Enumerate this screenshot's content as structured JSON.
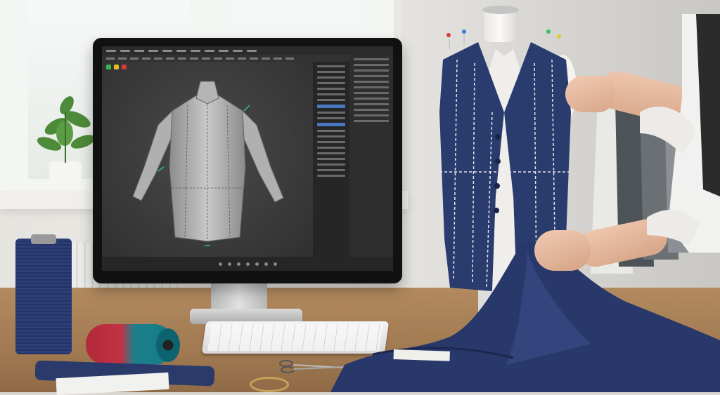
{
  "scene": {
    "description_free": true
  },
  "screen_ui": {
    "app_toolbar_colors": {
      "green": "#3cb44b",
      "yellow": "#e0c020",
      "red": "#d23c3c"
    },
    "selection_color": "#4a78c0",
    "viewport_bg": "#3a3a3a"
  },
  "colors": {
    "fabric_navy": "#2a3b6e",
    "thread_white": "#e8e8e8",
    "desk_wood": "#a17a52"
  },
  "icons": {
    "scissors": "scissors-icon",
    "tape_measure": "tape-measure-icon"
  }
}
